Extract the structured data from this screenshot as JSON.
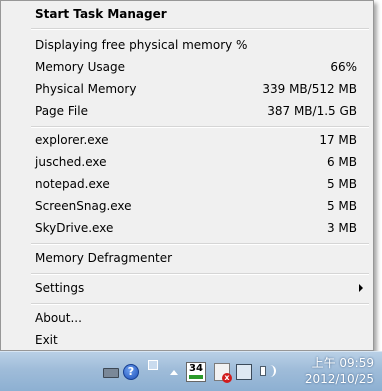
{
  "menu": {
    "title": "Start Task Manager",
    "display_mode": "Displaying free physical memory %",
    "stats": [
      {
        "label": "Memory Usage",
        "value": "66%"
      },
      {
        "label": "Physical Memory",
        "value": "339 MB/512 MB"
      },
      {
        "label": "Page File",
        "value": "387 MB/1.5 GB"
      }
    ],
    "processes": [
      {
        "name": "explorer.exe",
        "memory": "17 MB"
      },
      {
        "name": "jusched.exe",
        "memory": "6 MB"
      },
      {
        "name": "notepad.exe",
        "memory": "5 MB"
      },
      {
        "name": "ScreenSnag.exe",
        "memory": "5 MB"
      },
      {
        "name": "SkyDrive.exe",
        "memory": "3 MB"
      }
    ],
    "defragmenter": "Memory Defragmenter",
    "settings": "Settings",
    "about": "About...",
    "exit": "Exit"
  },
  "taskbar": {
    "tray_icons": [
      "keyboard-icon",
      "help-icon",
      "screens-icon",
      "show-hidden-icons-arrow",
      "34",
      "action-center-flag-icon",
      "network-icon",
      "volume-icon"
    ],
    "tray_badge": "34",
    "help_glyph": "?",
    "flag_glyph": "x",
    "clock_time": "上午 09:59",
    "clock_date": "2012/10/25"
  }
}
